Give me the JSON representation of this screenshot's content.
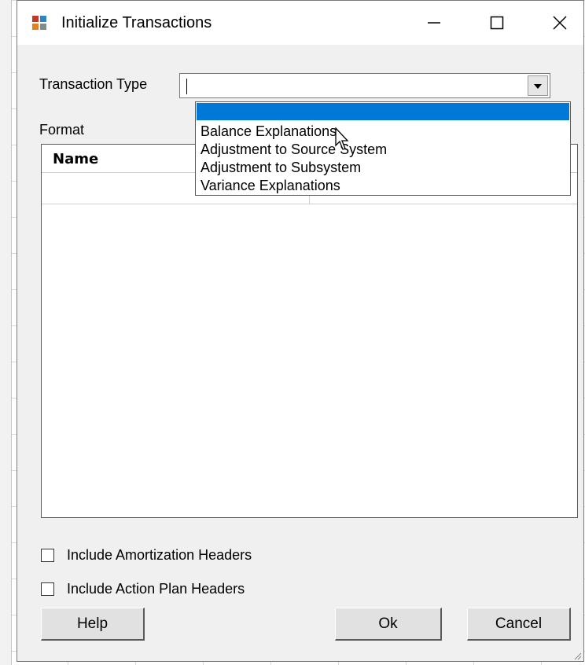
{
  "window": {
    "title": "Initialize Transactions",
    "icon": "app-icon",
    "controls": [
      "minimize-icon",
      "maximize-icon",
      "close-icon"
    ]
  },
  "form": {
    "transaction_type_label": "Transaction Type",
    "transaction_type_value": "",
    "format_label": "Format"
  },
  "dropdown": {
    "selected_index": 0,
    "items": [
      "",
      "Balance Explanations",
      "Adjustment to Source System",
      "Adjustment to Subsystem",
      "Variance Explanations"
    ]
  },
  "grid": {
    "columns": [
      "Name"
    ]
  },
  "options": [
    {
      "label": "Include Amortization Headers",
      "checked": false
    },
    {
      "label": "Include Action Plan Headers",
      "checked": false
    }
  ],
  "buttons": {
    "help": "Help",
    "ok": "Ok",
    "cancel": "Cancel"
  },
  "colors": {
    "selection": "#0078d7",
    "dialog_bg": "#f0f0f0"
  }
}
